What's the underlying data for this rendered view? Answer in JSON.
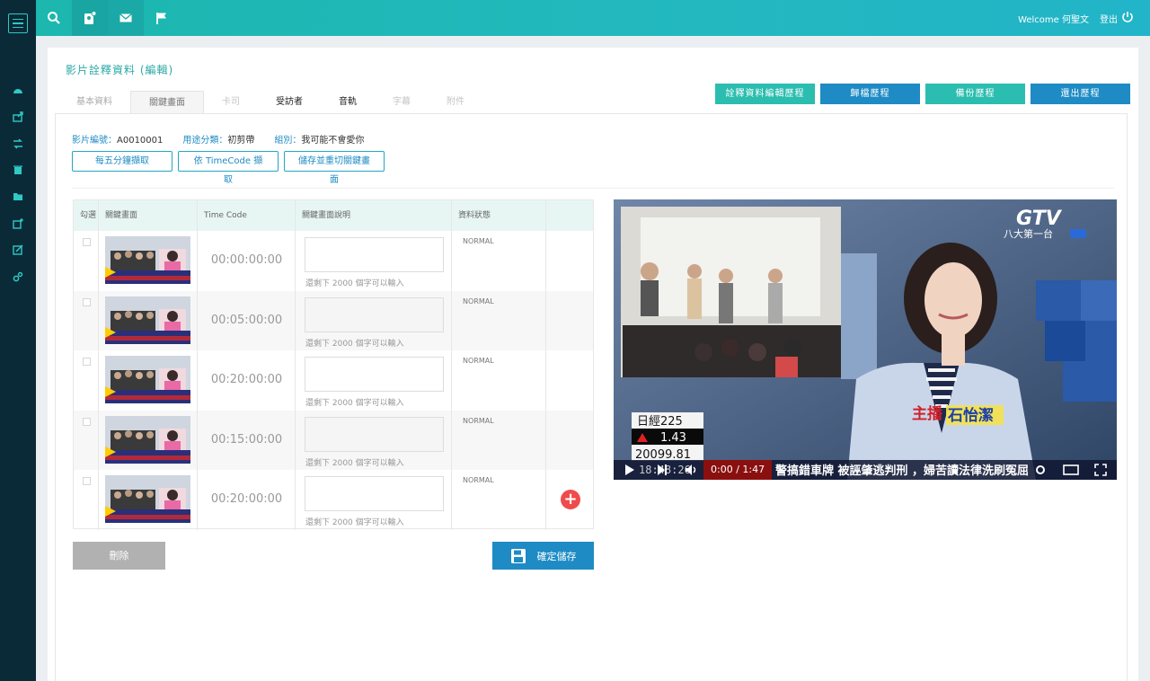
{
  "topbar": {
    "icons": [
      "search-icon",
      "user-badge-icon",
      "mail-icon",
      "flag-icon"
    ],
    "welcome": "Welcome 何聖文",
    "logout": "登出"
  },
  "sidebar": {
    "icons": [
      "menu-icon",
      "dashboard-icon",
      "export-icon",
      "transfer-icon",
      "trash-icon",
      "folder-icon",
      "add-file-icon",
      "edit-icon",
      "settings-icon"
    ]
  },
  "page": {
    "title": "影片詮釋資料 (編輯)",
    "tabs": [
      {
        "label": "基本資料"
      },
      {
        "label": "關鍵畫面"
      },
      {
        "label": "卡司"
      },
      {
        "label": "受訪者"
      },
      {
        "label": "音軌"
      },
      {
        "label": "字幕"
      },
      {
        "label": "附件"
      }
    ],
    "history_buttons": [
      "詮釋資料編輯歷程",
      "歸檔歷程",
      "備份歷程",
      "還出歷程"
    ]
  },
  "meta": {
    "video_no_label": "影片編號：",
    "video_no": "A0010001",
    "usage_label": "用途分類：",
    "usage": "初剪帶",
    "group_label": "組別：",
    "group": "我可能不會愛你"
  },
  "actions": [
    "每五分鐘擷取",
    "依 TimeCode 擷取",
    "儲存並重切關鍵畫面"
  ],
  "table": {
    "headers": [
      "勾選",
      "關鍵畫面",
      "Time Code",
      "關鍵畫面說明",
      "資料狀態",
      ""
    ],
    "rows": [
      {
        "timecode": "00:00:00:00",
        "hint": "還剩下 2000 個字可以輸入",
        "status": "NORMAL"
      },
      {
        "timecode": "00:05:00:00",
        "hint": "還剩下 2000 個字可以輸入",
        "status": "NORMAL"
      },
      {
        "timecode": "00:20:00:00",
        "hint": "還剩下 2000 個字可以輸入",
        "status": "NORMAL"
      },
      {
        "timecode": "00:15:00:00",
        "hint": "還剩下 2000 個字可以輸入",
        "status": "NORMAL"
      },
      {
        "timecode": "00:20:00:00",
        "hint": "還剩下 2000 個字可以輸入",
        "status": "NORMAL"
      }
    ]
  },
  "buttons": {
    "delete": "刪除",
    "save": "確定儲存"
  },
  "video": {
    "channel": "GTV",
    "channel_sub": "八大第一台",
    "anchor_label": "主播",
    "anchor_name": "石怡潔",
    "stock_name": "日經225",
    "stock_change": "1.43",
    "stock_value": "20099.81",
    "clock": "18:48:26",
    "time": "0:00 / 1:47",
    "ticker": "警搞錯車牌 被誣肇逃判刑 ，婦苦讀法律洗刷冤屈"
  }
}
